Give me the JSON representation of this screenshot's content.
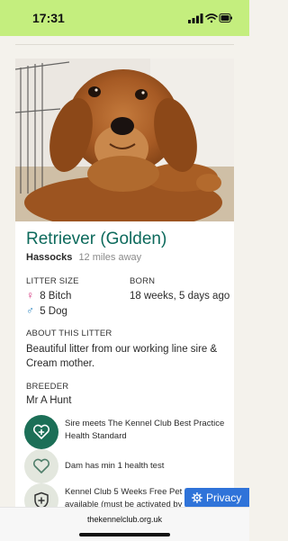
{
  "status_bar": {
    "time": "17:31",
    "background": "#c4ee7e"
  },
  "listing": {
    "title": "Retriever (Golden)",
    "location": "Hassocks",
    "distance": "12 miles away",
    "photo_icon": "golden-retriever-puppy-photo",
    "litter_size": {
      "label": "LITTER SIZE",
      "female_count": "8 Bitch",
      "male_count": "5 Dog",
      "female_icon": "female-symbol-icon",
      "male_icon": "male-symbol-icon"
    },
    "born": {
      "label": "BORN",
      "value": "18 weeks, 5 days ago"
    },
    "about": {
      "label": "ABOUT THIS LITTER",
      "text": "Beautiful litter from our working line sire & Cream mother."
    },
    "breeder": {
      "label": "BREEDER",
      "name": "Mr A Hunt"
    },
    "features": [
      {
        "text": "Sire meets The Kennel Club Best Practice Health Standard",
        "icon": "heart-plus-icon",
        "style": "dark"
      },
      {
        "text": "Dam has min 1 health test",
        "icon": "heart-icon",
        "style": "light"
      },
      {
        "text": "Kennel Club 5 Weeks Free Pet Insurance available (must be activated by",
        "icon": "shield-plus-icon",
        "style": "light"
      }
    ]
  },
  "privacy_button": {
    "label": "Privacy",
    "icon": "gear-icon",
    "color": "#2f73d9"
  },
  "browser": {
    "url": "thekennelclub.org.uk"
  },
  "colors": {
    "title": "#0d6a5c",
    "badge_dark": "#1c6f57",
    "female": "#d3327c",
    "male": "#2e86c1"
  }
}
